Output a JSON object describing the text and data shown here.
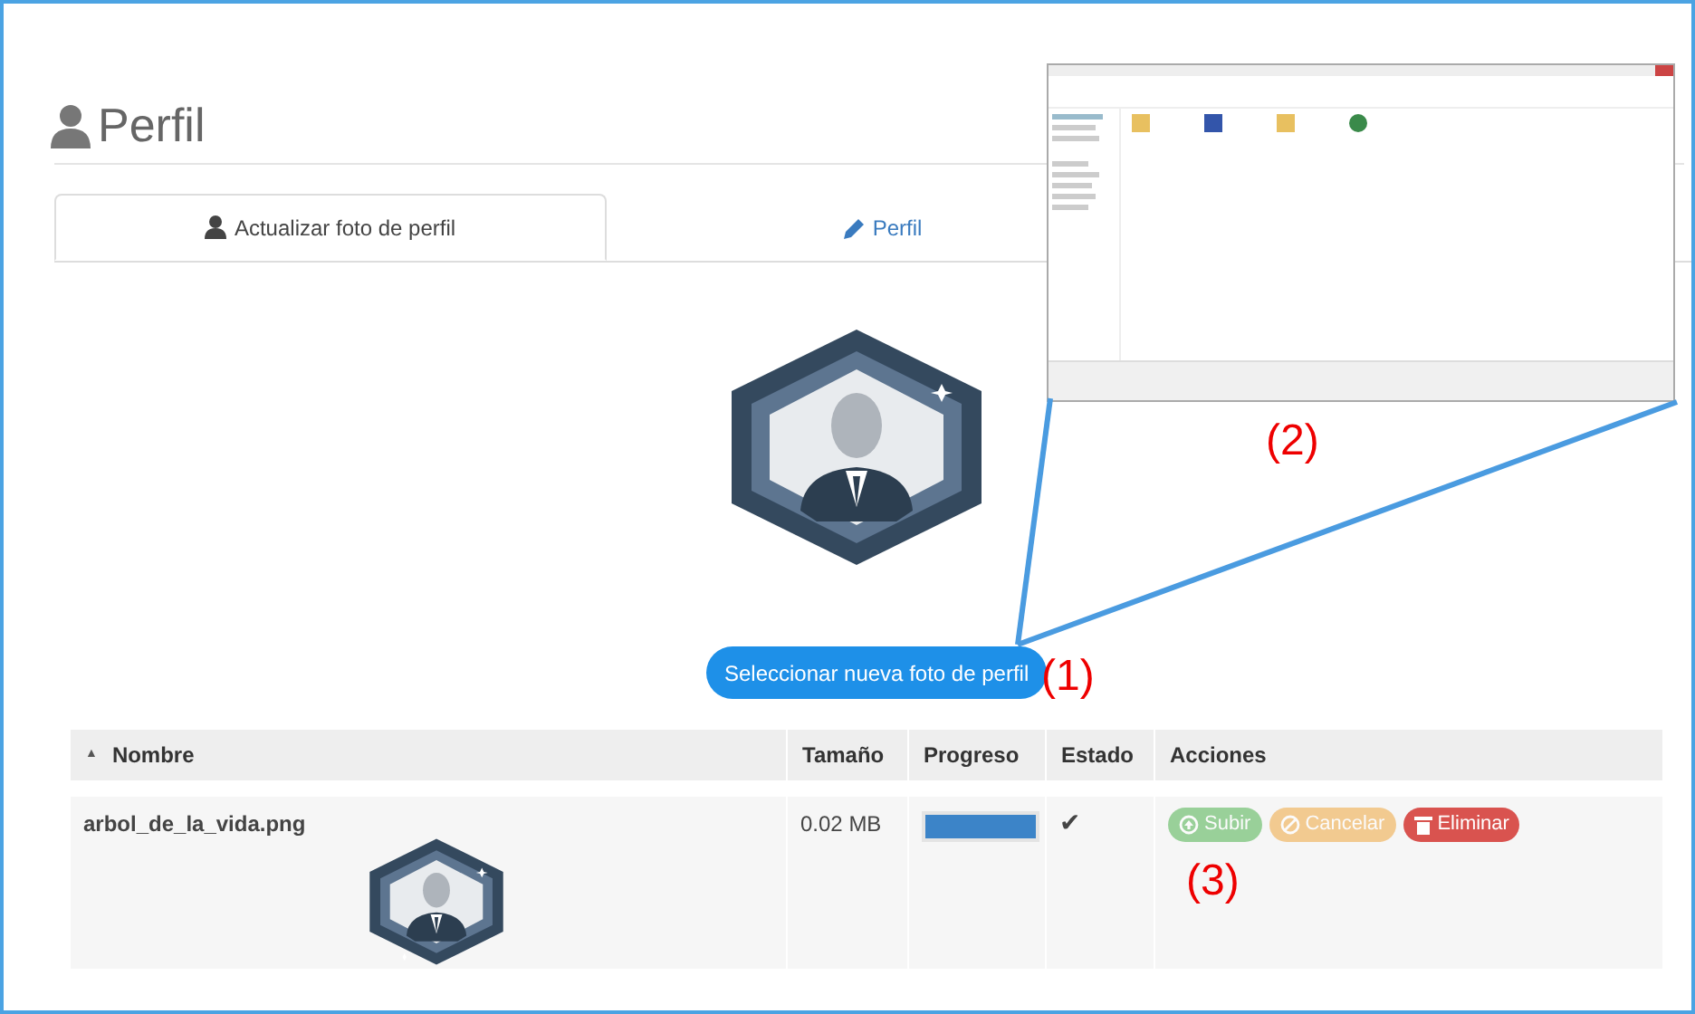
{
  "page_title": "Perfil",
  "tabs": [
    {
      "label": "Actualizar foto de perfil",
      "kind": "user",
      "selected": true
    },
    {
      "label": "Perfil",
      "kind": "edit",
      "selected": false
    }
  ],
  "select_button": "Seleccionar nueva foto de perfil",
  "callouts": [
    "(1)",
    "(2)",
    "(3)"
  ],
  "table": {
    "columns": [
      {
        "label": "Nombre",
        "sort_marker": "▲"
      },
      {
        "label": "Tamaño"
      },
      {
        "label": "Progreso"
      },
      {
        "label": "Estado"
      },
      {
        "label": "Acciones"
      }
    ],
    "rows": [
      {
        "name": "arbol_de_la_vida.png",
        "size": "0.02 MB",
        "level": 1,
        "status": "✔",
        "actions": [
          {
            "label": "Subir",
            "kind": "upload",
            "disabled": true
          },
          {
            "label": "Cancelar",
            "kind": "cancel",
            "disabled": true
          },
          {
            "label": "Eliminar",
            "kind": "delete",
            "disabled": false
          }
        ]
      }
    ]
  }
}
